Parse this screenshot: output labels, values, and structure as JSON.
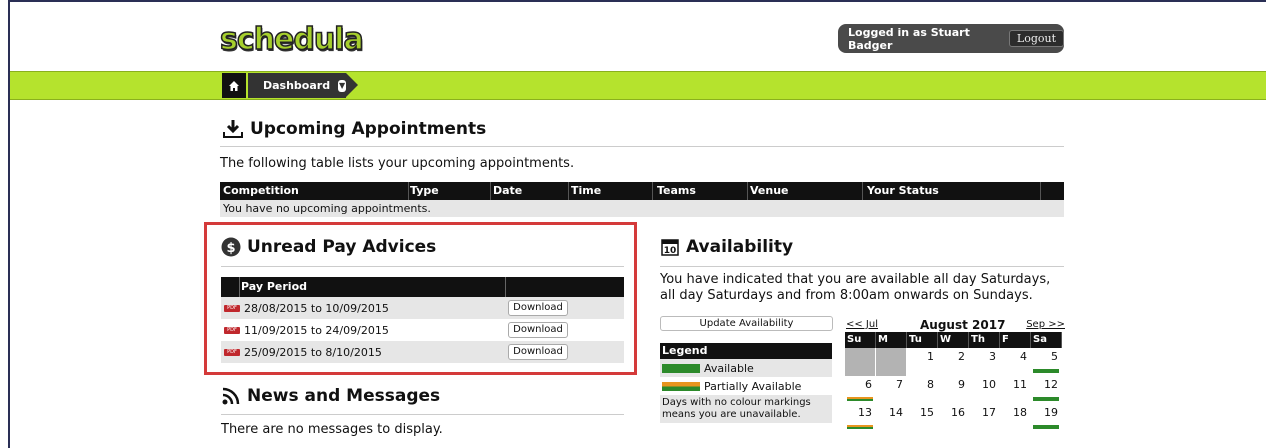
{
  "header": {
    "logo": "schedula",
    "login_text": "Logged in as Stuart Badger",
    "logout_label": "Logout"
  },
  "nav": {
    "home_icon": "home-icon",
    "dashboard_label": "Dashboard"
  },
  "upcoming": {
    "title": "Upcoming Appointments",
    "icon": "download-tray-icon",
    "description": "The following table lists your upcoming appointments.",
    "columns": [
      "Competition",
      "Type",
      "Date",
      "Time",
      "Teams",
      "Venue",
      "Your Status"
    ],
    "empty_text": "You have no upcoming appointments."
  },
  "pay": {
    "title": "Unread Pay Advices",
    "icon": "dollar-circle-icon",
    "column": "Pay Period",
    "rows": [
      {
        "period": "28/08/2015 to 10/09/2015",
        "action": "Download"
      },
      {
        "period": "11/09/2015 to 24/09/2015",
        "action": "Download"
      },
      {
        "period": "25/09/2015 to 8/10/2015",
        "action": "Download"
      }
    ]
  },
  "news": {
    "title": "News and Messages",
    "icon": "rss-icon",
    "empty_text": "There are no messages to display."
  },
  "availability": {
    "title": "Availability",
    "icon": "calendar-icon",
    "calendar_icon_number": "10",
    "description": "You have indicated that you are available all day Saturdays, all day Saturdays and from 8:00am onwards on Sundays.",
    "update_label": "Update Availability",
    "legend": {
      "title": "Legend",
      "available": "Available",
      "partial": "Partially Available",
      "note": "Days with no colour markings means you are unavailable."
    },
    "calendar": {
      "prev": "<< Jul",
      "month": "August 2017",
      "next": "Sep >>",
      "day_headers": [
        "Su",
        "M",
        "Tu",
        "W",
        "Th",
        "F",
        "Sa"
      ],
      "week1": [
        "",
        "",
        "1",
        "2",
        "3",
        "4",
        "5"
      ],
      "week2": [
        "6",
        "7",
        "8",
        "9",
        "10",
        "11",
        "12"
      ],
      "week3": [
        "13",
        "14",
        "15",
        "16",
        "17",
        "18",
        "19"
      ]
    },
    "colors": {
      "available": "#2c8a2a",
      "partial": "#e8951e"
    }
  }
}
